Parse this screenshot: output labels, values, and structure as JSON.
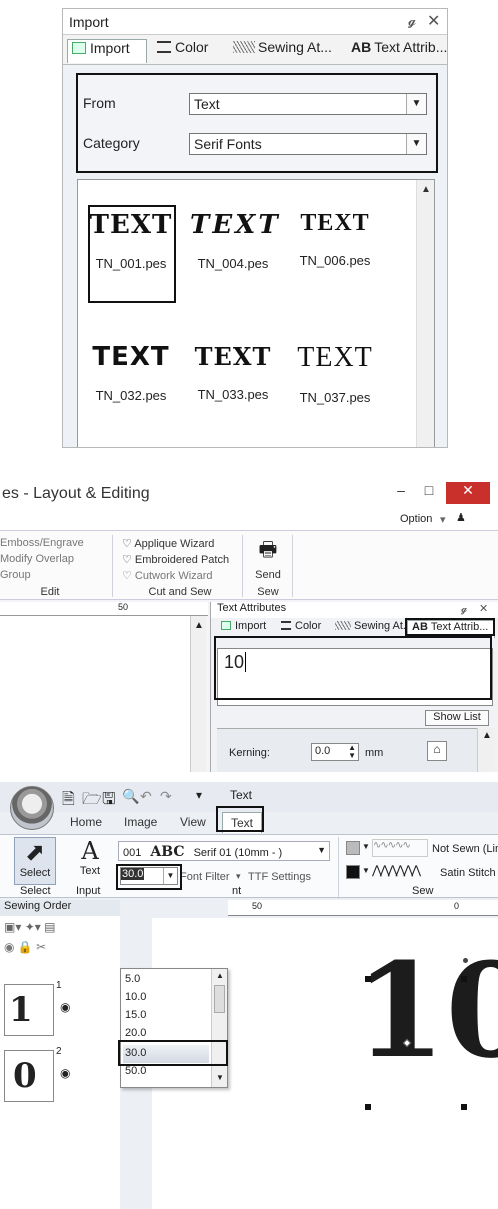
{
  "panel1": {
    "title": "Import",
    "pin": "p",
    "close": "✕",
    "tabs": [
      "Import",
      "Color",
      "Sewing At...",
      "Text Attrib..."
    ],
    "tab_ab": "AB",
    "from_label": "From",
    "from_value": "Text",
    "category_label": "Category",
    "category_value": "Serif Fonts",
    "thumbnails": [
      {
        "glyph": "TEXT",
        "file": "TN_001.pes"
      },
      {
        "glyph": "TEXT",
        "file": "TN_004.pes"
      },
      {
        "glyph": "TEXT",
        "file": "TN_006.pes"
      },
      {
        "glyph": "TEXT",
        "file": "TN_032.pes"
      },
      {
        "glyph": "TEXT",
        "file": "TN_033.pes"
      },
      {
        "glyph": "TEXT",
        "file": "TN_037.pes"
      }
    ]
  },
  "panel2": {
    "title": "es - Layout & Editing",
    "option": "Option",
    "ribbon": {
      "emboss": "Emboss/Engrave",
      "modify_overlap": "Modify Overlap",
      "group": "Group",
      "edit_group": "Edit",
      "applique": "Applique Wizard",
      "embroidered_patch": "Embroidered Patch",
      "cutwork": "Cutwork Wizard",
      "cut_group": "Cut and Sew",
      "send": "Send",
      "sew_group": "Sew"
    },
    "ruler_mark": "50",
    "ta_title": "Text Attributes",
    "tabs": [
      "Import",
      "Color",
      "Sewing At.",
      "Text Attrib..."
    ],
    "tab_ab": "AB",
    "text_value": "10",
    "show_list": "Show List",
    "kerning_label": "Kerning:",
    "kerning_value": "0.0",
    "kerning_unit": "mm"
  },
  "panel3": {
    "context_tab": "Text",
    "tabs": [
      "Home",
      "Image",
      "View",
      "Text"
    ],
    "select_label": "Select",
    "text_label": "Text",
    "select_group": "Select",
    "input_group": "Input",
    "font_no": "001",
    "font_sample": "ABC",
    "font_name": "Serif 01  (10mm - )",
    "size_value": "30.0",
    "font_filter": "Font Filter",
    "ttf_settings": "TTF Settings",
    "font_group_tail": "nt",
    "not_sewn": "Not Sewn (Lin",
    "satin": "Satin Stitch",
    "sew_group": "Sew",
    "sewing_order": "Sewing Order",
    "size_options": [
      "5.0",
      "10.0",
      "15.0",
      "20.0",
      "30.0",
      "50.0"
    ],
    "ruler_50": "50",
    "ruler_0": "0",
    "order_items": [
      {
        "num": "1",
        "glyph": "1"
      },
      {
        "num": "2",
        "glyph": "0"
      }
    ],
    "canvas_text": "10"
  }
}
